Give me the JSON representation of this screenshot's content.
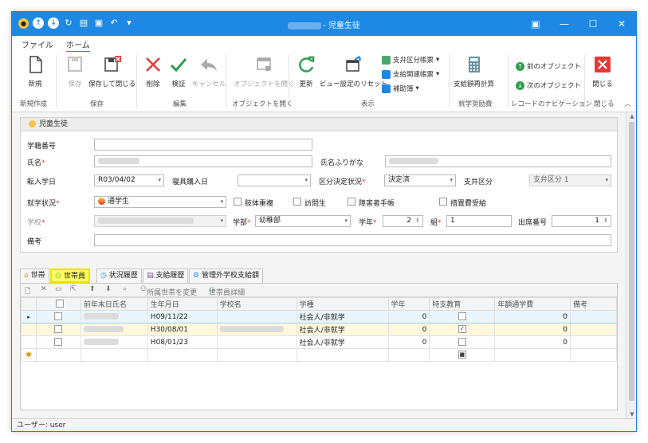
{
  "window": {
    "title": "- 児童生徒",
    "controls": [
      "▣",
      "—",
      "☐",
      "✕"
    ]
  },
  "ribbon_tabs": [
    "ファイル",
    "ホーム"
  ],
  "ribbon": {
    "new": "新規",
    "save": "保存",
    "save_close": "保存して閉じる",
    "delete": "削除",
    "verify": "検証",
    "cancel": "キャンセル",
    "open_object": "オブジェクトを開く",
    "refresh": "更新",
    "reset_view": "ビュー設定のリセット",
    "support_category_report": "支弁区分帳票",
    "support_related_report": "支給関連帳票",
    "aux_ledger": "補助簿",
    "recalc": "支給額再計算",
    "prev_object": "前のオブジェクト",
    "next_object": "次のオブジェクト",
    "close": "閉じる",
    "groups": {
      "new_create": "新規作成",
      "save": "保存",
      "edit": "編集",
      "open_object": "オブジェクトを開く",
      "display": "表示",
      "school_aid": "就学奨励費",
      "record_nav": "レコードのナビゲーション",
      "close": "閉じる"
    }
  },
  "panel": {
    "title": "児童生徒"
  },
  "form": {
    "student_number_label": "学籍番号",
    "name_label": "氏名",
    "kana_label": "氏名ふりがな",
    "transfer_date_label": "転入学日",
    "transfer_date_value": "R03/04/02",
    "bedding_label": "寝具購入日",
    "category_status_label": "区分決定状況",
    "category_status_value": "決定済",
    "support_category_label": "支弁区分",
    "support_category_value": "支弁区分 1",
    "enrollment_label": "就学状況",
    "enrollment_value": "通学生",
    "checks": [
      "肢体重複",
      "訪問生",
      "障害者手帳",
      "措置費受給"
    ],
    "school_label": "学校",
    "dept_label": "学部",
    "dept_value": "幼稚部",
    "grade_label": "学年",
    "grade_value": "2",
    "class_label": "組",
    "class_value": "1",
    "attendance_label": "出席番号",
    "attendance_value": "1",
    "remarks_label": "備考"
  },
  "tabs": [
    "世帯",
    "世帯員",
    "状況履歴",
    "支給履歴",
    "管理外学校支給額"
  ],
  "grid_toolbar": {
    "change_household": "所属世帯を変更",
    "member_detail": "世帯員詳細"
  },
  "grid": {
    "columns": [
      "",
      "",
      "前年末日氏名",
      "生年月日",
      "学校名",
      "学種",
      "学年",
      "特支教育",
      "年額通学費",
      "備考"
    ],
    "rows": [
      {
        "birth": "H09/11/22",
        "type": "社会人/非就学",
        "grade": "0",
        "special": false,
        "fee": "0"
      },
      {
        "birth": "H30/08/01",
        "type": "社会人/非就学",
        "grade": "0",
        "special": true,
        "fee": "0"
      },
      {
        "birth": "H08/01/23",
        "type": "社会人/非就学",
        "grade": "0",
        "special": false,
        "fee": "0"
      }
    ]
  },
  "status": {
    "user": "ユーザー: user"
  }
}
